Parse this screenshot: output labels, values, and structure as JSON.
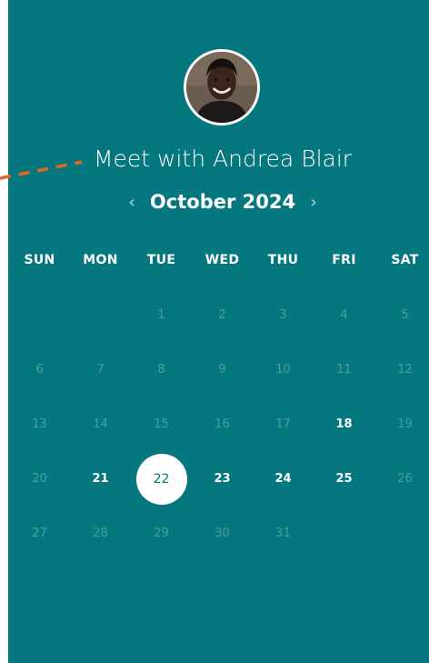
{
  "title": "Meet with Andrea Blair",
  "calendar": {
    "month_label": "October 2024",
    "prev_icon": "‹",
    "next_icon": "›",
    "weekdays": [
      "SUN",
      "MON",
      "TUE",
      "WED",
      "THU",
      "FRI",
      "SAT"
    ],
    "weeks": [
      [
        "",
        "",
        "1",
        "2",
        "3",
        "4",
        "5"
      ],
      [
        "6",
        "7",
        "8",
        "9",
        "10",
        "11",
        "12"
      ],
      [
        "13",
        "14",
        "15",
        "16",
        "17",
        "18",
        "19"
      ],
      [
        "20",
        "21",
        "22",
        "23",
        "24",
        "25",
        "26"
      ],
      [
        "27",
        "28",
        "29",
        "30",
        "31",
        "",
        ""
      ]
    ],
    "available_days": [
      "18",
      "21",
      "23",
      "24",
      "25"
    ],
    "selected_day": "22"
  },
  "colors": {
    "panel": "#05777f",
    "accent_dash": "#e8651f",
    "text": "#ffffff"
  },
  "icons": {
    "avatar": "host-avatar",
    "connector": "dashed-connector"
  }
}
